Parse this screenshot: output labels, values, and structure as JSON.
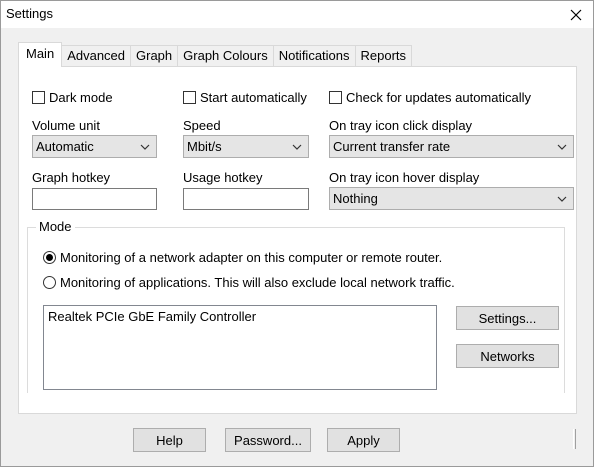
{
  "window": {
    "title": "Settings"
  },
  "tabs": [
    "Main",
    "Advanced",
    "Graph",
    "Graph Colours",
    "Notifications",
    "Reports"
  ],
  "main": {
    "dark_mode": {
      "label": "Dark mode",
      "checked": false
    },
    "start_automatically": {
      "label": "Start automatically",
      "checked": false
    },
    "check_updates": {
      "label": "Check for updates automatically",
      "checked": false
    },
    "volume_unit": {
      "label": "Volume unit",
      "value": "Automatic"
    },
    "speed": {
      "label": "Speed",
      "value": "Mbit/s"
    },
    "tray_click": {
      "label": "On tray icon click display",
      "value": "Current transfer rate"
    },
    "graph_hotkey": {
      "label": "Graph hotkey",
      "value": ""
    },
    "usage_hotkey": {
      "label": "Usage hotkey",
      "value": ""
    },
    "tray_hover": {
      "label": "On tray icon hover display",
      "value": "Nothing"
    }
  },
  "mode": {
    "label": "Mode",
    "option_adapter": "Monitoring of a network adapter on this computer or remote router.",
    "option_apps": "Monitoring of applications. This will also exclude local network traffic.",
    "selected": "adapter",
    "adapters": [
      "Realtek PCIe GbE Family Controller"
    ],
    "settings_button": "Settings...",
    "networks_button": "Networks"
  },
  "footer": {
    "help": "Help",
    "password": "Password...",
    "apply": "Apply"
  }
}
